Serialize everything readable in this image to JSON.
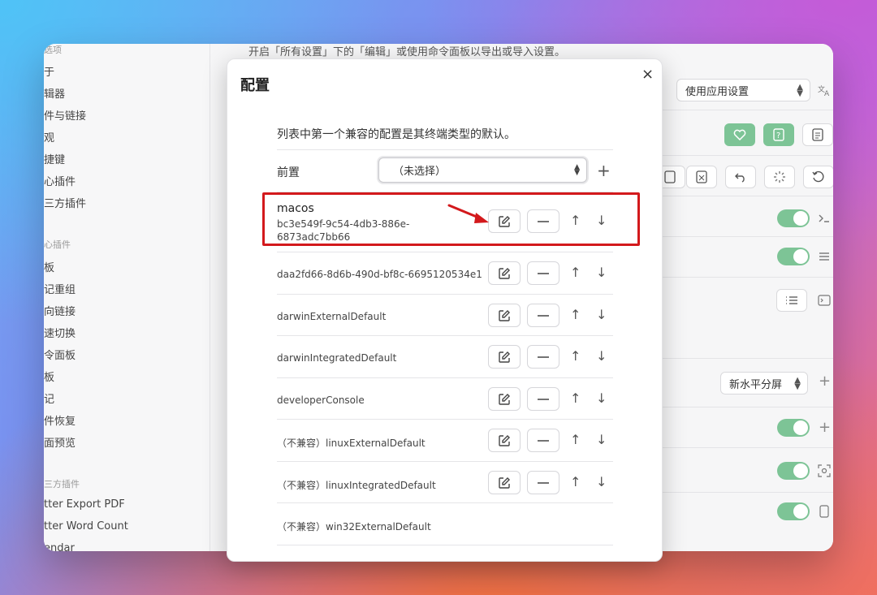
{
  "sidebar": {
    "heads": [
      "选项",
      "心插件",
      "三方插件"
    ],
    "items": [
      "于",
      "辑器",
      "件与链接",
      "观",
      "捷键",
      "心插件",
      "三方插件"
    ],
    "core_items": [
      "板",
      "记重组",
      "向链接",
      "速切换",
      "令面板",
      "板",
      "记",
      "件恢复",
      "面预览"
    ],
    "third_items": [
      "tter Export PDF",
      "tter Word Count",
      "endar"
    ]
  },
  "top_desc": "开启「所有设置」下的「编辑」或使用命令面板以导出或导入设置。",
  "right_panel": {
    "lang_select": "使用应用设置",
    "split_select": "新水平分屏",
    "toggles": [
      "on",
      "on",
      "on",
      "on",
      "on"
    ]
  },
  "modal": {
    "title": "配置",
    "close": "×",
    "description": "列表中第一个兼容的配置是其终端类型的默认。",
    "front_label": "前置",
    "front_select": "（未选择）",
    "profiles": [
      {
        "name": "macos",
        "sub": "bc3e549f-9c54-4db3-886e-6873adc7bb66",
        "highlighted": true
      },
      {
        "name": "daa2fd66-8d6b-490d-bf8c-6695120534e1"
      },
      {
        "name": "darwinExternalDefault"
      },
      {
        "name": "darwinIntegratedDefault"
      },
      {
        "name": "developerConsole"
      },
      {
        "name": "（不兼容）linuxExternalDefault"
      },
      {
        "name": "（不兼容）linuxIntegratedDefault"
      },
      {
        "name": "（不兼容）win32ExternalDefault"
      }
    ]
  },
  "colors": {
    "accent_green": "#7dc496",
    "highlight_red": "#d3191c"
  }
}
